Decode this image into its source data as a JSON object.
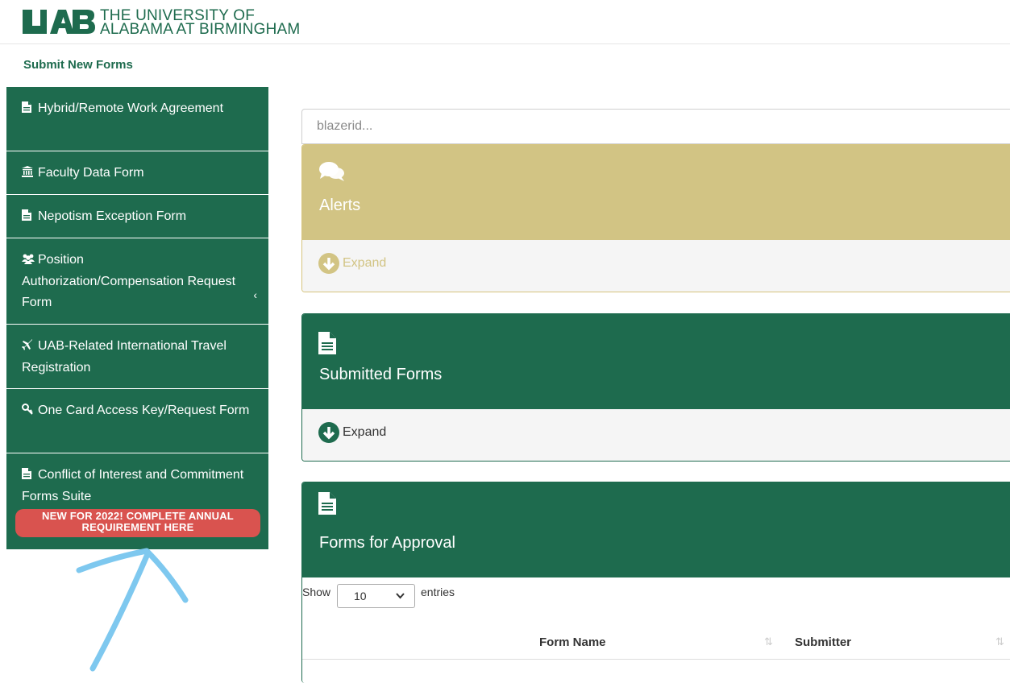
{
  "header": {
    "university_line1": "THE UNIVERSITY OF",
    "university_line2": "ALABAMA AT BIRMINGHAM",
    "brand_color": "#1e6b4e"
  },
  "sidebar": {
    "title": "Submit New Forms",
    "items": [
      {
        "label": "Hybrid/Remote Work Agreement",
        "icon": "document-icon"
      },
      {
        "label": "Faculty Data Form",
        "icon": "institution-icon"
      },
      {
        "label": "Nepotism Exception Form",
        "icon": "document-icon"
      },
      {
        "label": "Position Authorization/Compensation Request Form",
        "icon": "users-icon"
      },
      {
        "label": "UAB-Related International Travel Registration",
        "icon": "plane-icon"
      },
      {
        "label": "One Card Access Key/Request Form",
        "icon": "key-icon"
      },
      {
        "label": "Conflict of Interest and Commitment Forms Suite",
        "icon": "document-icon",
        "badge": "NEW FOR 2022! COMPLETE ANNUAL REQUIREMENT HERE"
      }
    ]
  },
  "search": {
    "placeholder": "blazerid..."
  },
  "panels": {
    "alerts": {
      "title": "Alerts",
      "expand_label": "Expand",
      "color": "#d2c484"
    },
    "submitted": {
      "title": "Submitted Forms",
      "expand_label": "Expand",
      "color": "#1e6b4e"
    },
    "approval": {
      "title": "Forms for Approval",
      "show_label": "Show",
      "entries_label": "entries",
      "page_size": "10",
      "columns": [
        "Form Name",
        "Submitter"
      ]
    }
  },
  "annotation": {
    "color": "#7ec8ef"
  }
}
